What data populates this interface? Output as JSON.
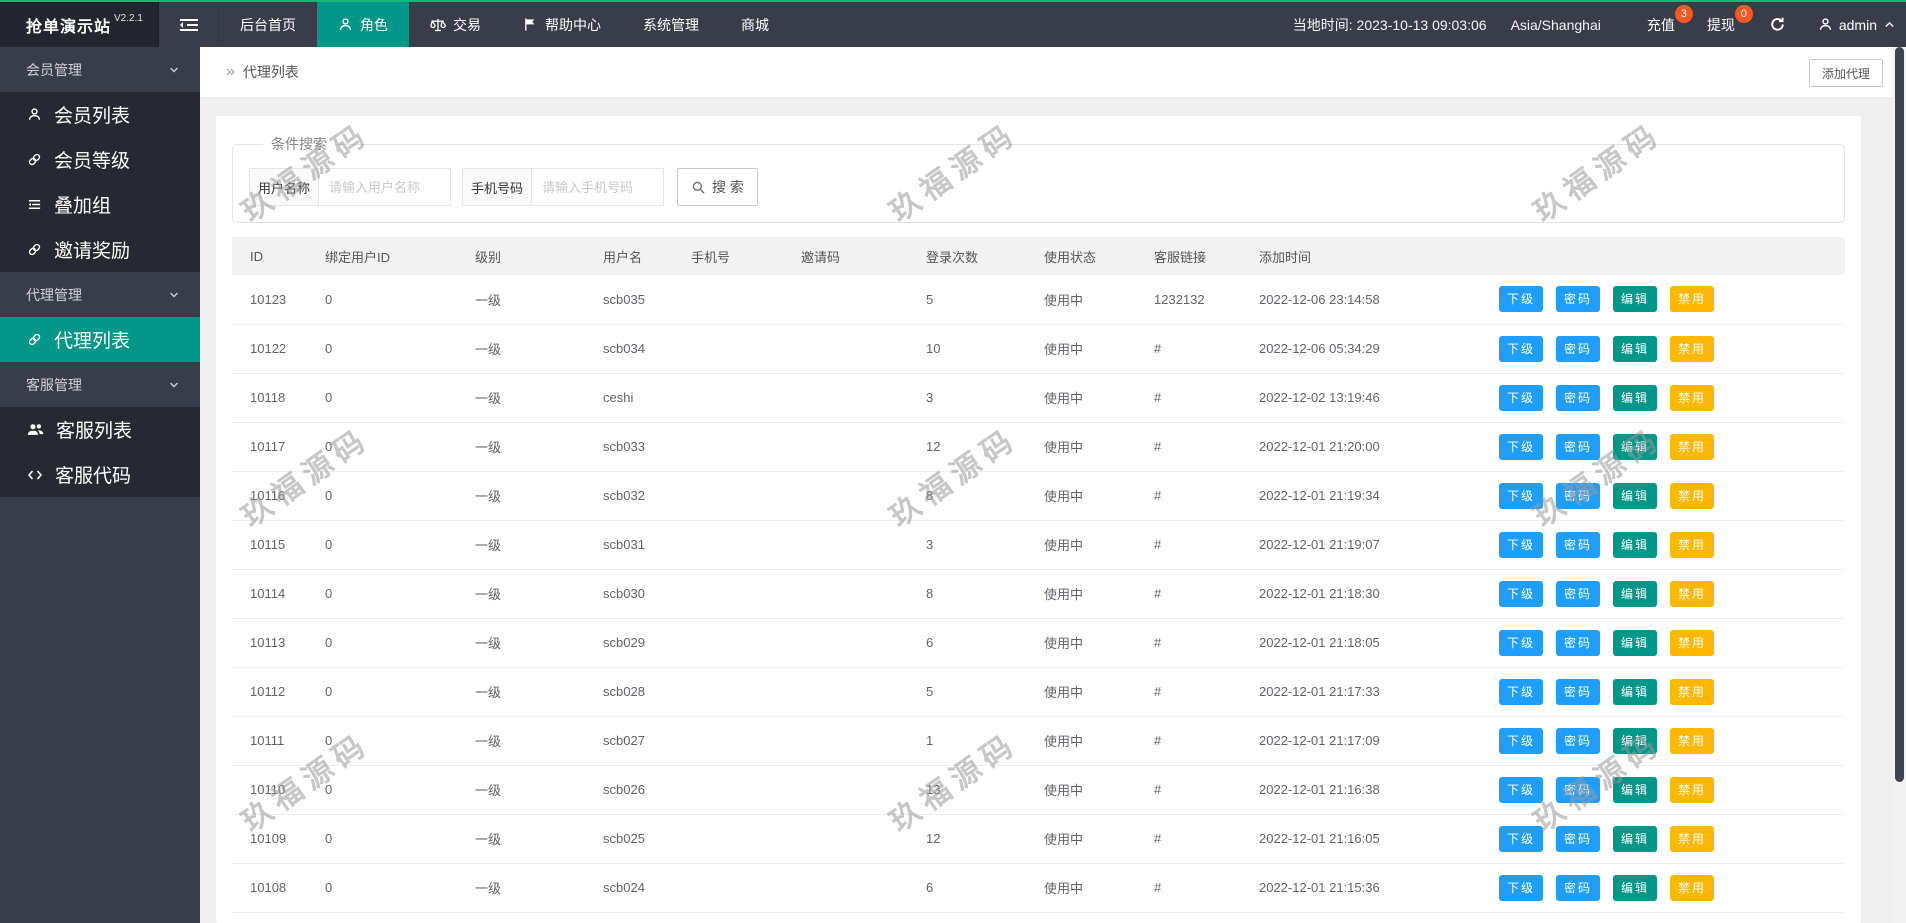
{
  "topbar": {
    "brand": "抢单演示站",
    "version": "V2.2.1",
    "nav": [
      {
        "label": "后台首页",
        "icon": null,
        "active": false
      },
      {
        "label": "角色",
        "icon": "person-icon",
        "active": true
      },
      {
        "label": "交易",
        "icon": "scales-icon",
        "active": false
      },
      {
        "label": "帮助中心",
        "icon": "flag-icon",
        "active": false
      },
      {
        "label": "系统管理",
        "icon": null,
        "active": false
      },
      {
        "label": "商城",
        "icon": null,
        "active": false
      }
    ],
    "local_time_label": "当地时间: 2023-10-13 09:03:06",
    "timezone": "Asia/Shanghai",
    "quick": [
      {
        "label": "充值",
        "badge": "3"
      },
      {
        "label": "提现",
        "badge": "0"
      }
    ],
    "username": "admin"
  },
  "sidebar": {
    "items": [
      {
        "type": "group",
        "label": "会员管理"
      },
      {
        "type": "item",
        "label": "会员列表",
        "icon": "person-icon",
        "active": false
      },
      {
        "type": "item",
        "label": "会员等级",
        "icon": "link-icon",
        "active": false
      },
      {
        "type": "item",
        "label": "叠加组",
        "icon": "list-icon",
        "active": false
      },
      {
        "type": "item",
        "label": "邀请奖励",
        "icon": "link-icon",
        "active": false
      },
      {
        "type": "group",
        "label": "代理管理"
      },
      {
        "type": "item",
        "label": "代理列表",
        "icon": "link-icon",
        "active": true
      },
      {
        "type": "group",
        "label": "客服管理"
      },
      {
        "type": "item",
        "label": "客服列表",
        "icon": "users-icon",
        "active": false
      },
      {
        "type": "item",
        "label": "客服代码",
        "icon": "code-icon",
        "active": false
      }
    ]
  },
  "page": {
    "breadcrumb": "代理列表",
    "add_button": "添加代理"
  },
  "search": {
    "legend": "条件搜索",
    "fields": [
      {
        "label": "用户名称",
        "placeholder": "请输入用户名称"
      },
      {
        "label": "手机号码",
        "placeholder": "请输入手机号码"
      }
    ],
    "button": "搜 索"
  },
  "table": {
    "columns": [
      "ID",
      "绑定用户ID",
      "级别",
      "用户名",
      "手机号",
      "邀请码",
      "登录次数",
      "使用状态",
      "客服链接",
      "添加时间"
    ],
    "actions": [
      "下级",
      "密码",
      "编辑",
      "禁用"
    ],
    "rows": [
      {
        "id": "10123",
        "bind_uid": "0",
        "level": "一级",
        "username": "scb035",
        "phone": "",
        "invite_code": "",
        "logins": "5",
        "status": "使用中",
        "service_link": "1232132",
        "created_at": "2022-12-06 23:14:58"
      },
      {
        "id": "10122",
        "bind_uid": "0",
        "level": "一级",
        "username": "scb034",
        "phone": "",
        "invite_code": "",
        "logins": "10",
        "status": "使用中",
        "service_link": "#",
        "created_at": "2022-12-06 05:34:29"
      },
      {
        "id": "10118",
        "bind_uid": "0",
        "level": "一级",
        "username": "ceshi",
        "phone": "",
        "invite_code": "",
        "logins": "3",
        "status": "使用中",
        "service_link": "#",
        "created_at": "2022-12-02 13:19:46"
      },
      {
        "id": "10117",
        "bind_uid": "0",
        "level": "一级",
        "username": "scb033",
        "phone": "",
        "invite_code": "",
        "logins": "12",
        "status": "使用中",
        "service_link": "#",
        "created_at": "2022-12-01 21:20:00"
      },
      {
        "id": "10116",
        "bind_uid": "0",
        "level": "一级",
        "username": "scb032",
        "phone": "",
        "invite_code": "",
        "logins": "8",
        "status": "使用中",
        "service_link": "#",
        "created_at": "2022-12-01 21:19:34"
      },
      {
        "id": "10115",
        "bind_uid": "0",
        "level": "一级",
        "username": "scb031",
        "phone": "",
        "invite_code": "",
        "logins": "3",
        "status": "使用中",
        "service_link": "#",
        "created_at": "2022-12-01 21:19:07"
      },
      {
        "id": "10114",
        "bind_uid": "0",
        "level": "一级",
        "username": "scb030",
        "phone": "",
        "invite_code": "",
        "logins": "8",
        "status": "使用中",
        "service_link": "#",
        "created_at": "2022-12-01 21:18:30"
      },
      {
        "id": "10113",
        "bind_uid": "0",
        "level": "一级",
        "username": "scb029",
        "phone": "",
        "invite_code": "",
        "logins": "6",
        "status": "使用中",
        "service_link": "#",
        "created_at": "2022-12-01 21:18:05"
      },
      {
        "id": "10112",
        "bind_uid": "0",
        "level": "一级",
        "username": "scb028",
        "phone": "",
        "invite_code": "",
        "logins": "5",
        "status": "使用中",
        "service_link": "#",
        "created_at": "2022-12-01 21:17:33"
      },
      {
        "id": "10111",
        "bind_uid": "0",
        "level": "一级",
        "username": "scb027",
        "phone": "",
        "invite_code": "",
        "logins": "1",
        "status": "使用中",
        "service_link": "#",
        "created_at": "2022-12-01 21:17:09"
      },
      {
        "id": "10110",
        "bind_uid": "0",
        "level": "一级",
        "username": "scb026",
        "phone": "",
        "invite_code": "",
        "logins": "13",
        "status": "使用中",
        "service_link": "#",
        "created_at": "2022-12-01 21:16:38"
      },
      {
        "id": "10109",
        "bind_uid": "0",
        "level": "一级",
        "username": "scb025",
        "phone": "",
        "invite_code": "",
        "logins": "12",
        "status": "使用中",
        "service_link": "#",
        "created_at": "2022-12-01 21:16:05"
      },
      {
        "id": "10108",
        "bind_uid": "0",
        "level": "一级",
        "username": "scb024",
        "phone": "",
        "invite_code": "",
        "logins": "6",
        "status": "使用中",
        "service_link": "#",
        "created_at": "2022-12-01 21:15:36"
      }
    ]
  },
  "watermark": "玖福源码",
  "colors": {
    "top_accent_green": "#16b777",
    "active_teal": "#009688",
    "badge_red": "#FF5722",
    "button_blue": "#1E9FFF",
    "button_teal": "#009688",
    "button_amber": "#FFB800",
    "status_green": "#3fb241",
    "topbar_bg": "#393D49",
    "logo_bg": "#23262E"
  }
}
